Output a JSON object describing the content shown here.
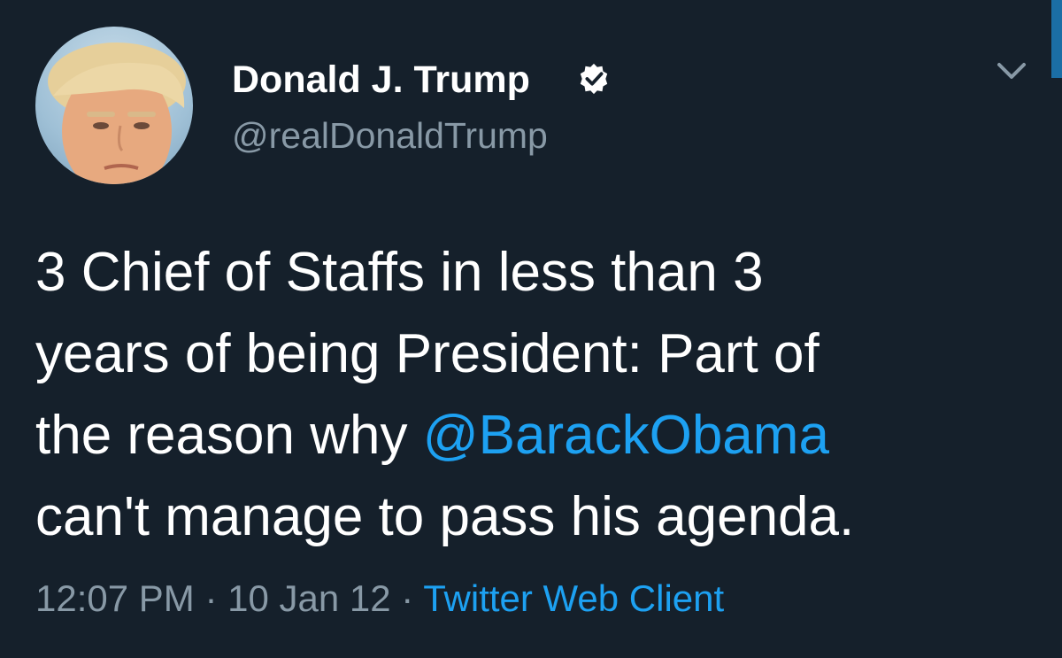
{
  "tweet": {
    "author": {
      "display_name": "Donald J. Trump",
      "handle": "@realDonaldTrump",
      "verified": true
    },
    "text": {
      "line1": "3 Chief of Staffs in less than 3",
      "line2": "years of being President: Part of",
      "line3_prefix": "the reason why ",
      "mention": "@BarackObama",
      "line4": "can't manage to pass his agenda."
    },
    "meta": {
      "time": "12:07 PM",
      "separator1": " · ",
      "date": "10 Jan 12",
      "separator2": " · ",
      "source": "Twitter Web Client"
    }
  },
  "icons": {
    "verified": "verified-badge-icon",
    "menu": "chevron-down-icon",
    "avatar": "profile-avatar"
  },
  "colors": {
    "background": "#15202b",
    "primary_text": "#ffffff",
    "secondary_text": "#8899a6",
    "link": "#1da1f2"
  }
}
